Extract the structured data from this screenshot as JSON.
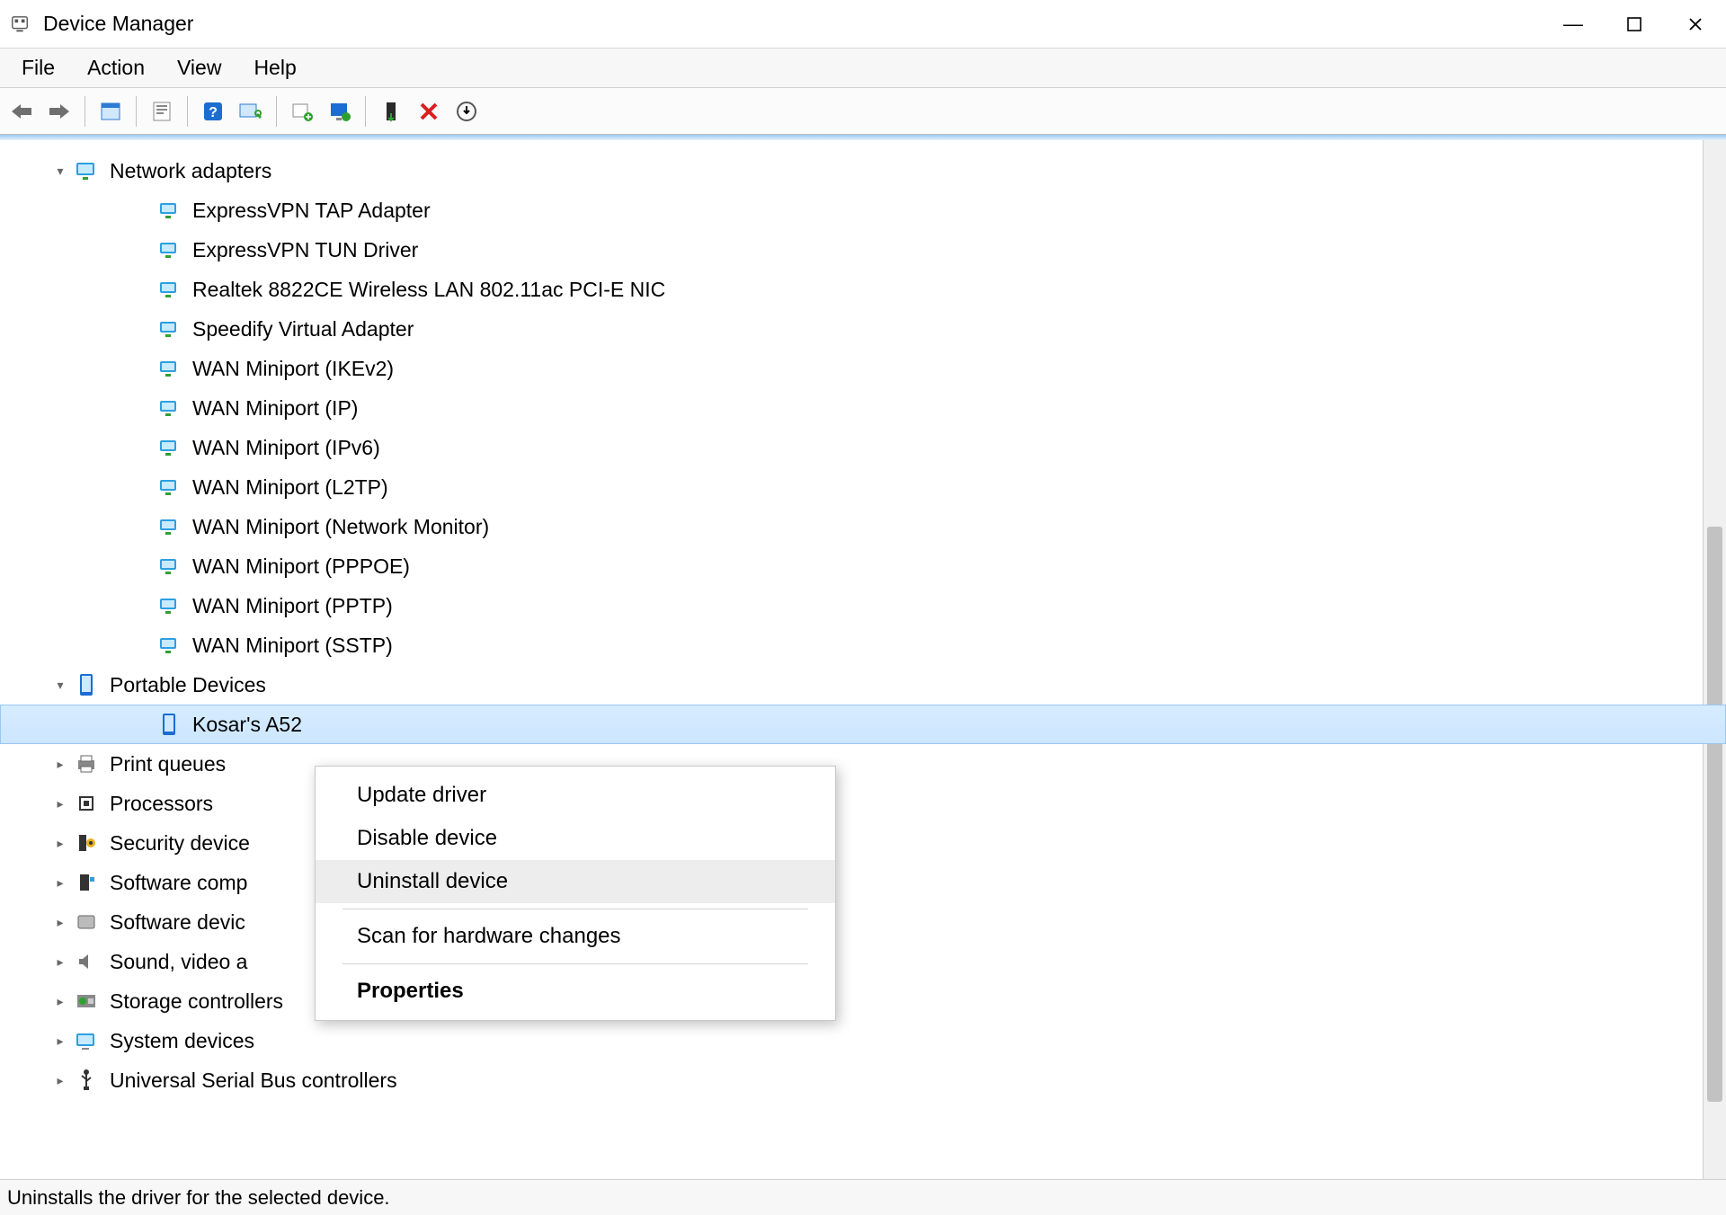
{
  "title": "Device Manager",
  "window_controls": {
    "min": "—",
    "max": "▢",
    "close": "✕"
  },
  "menu": {
    "file": "File",
    "action": "Action",
    "view": "View",
    "help": "Help"
  },
  "toolbar_icons": {
    "back": "back",
    "forward": "forward",
    "show_hidden": "show-hidden",
    "properties": "properties",
    "help": "help",
    "refresh": "refresh",
    "update_driver": "update-driver",
    "enable": "enable",
    "uninstall": "uninstall",
    "delete": "delete",
    "scan": "scan"
  },
  "tree": {
    "network_adapters": {
      "label": "Network adapters",
      "items": [
        "ExpressVPN TAP Adapter",
        "ExpressVPN TUN Driver",
        "Realtek 8822CE Wireless LAN 802.11ac PCI-E NIC",
        "Speedify Virtual Adapter",
        "WAN Miniport (IKEv2)",
        "WAN Miniport (IP)",
        "WAN Miniport (IPv6)",
        "WAN Miniport (L2TP)",
        "WAN Miniport (Network Monitor)",
        "WAN Miniport (PPPOE)",
        "WAN Miniport (PPTP)",
        "WAN Miniport (SSTP)"
      ]
    },
    "portable_devices": {
      "label": "Portable Devices",
      "selected_item": "Kosar's A52"
    },
    "print_queues": "Print queues",
    "processors": "Processors",
    "security_devices": "Security device",
    "software_components": "Software comp",
    "software_devices": "Software devic",
    "sound": "Sound, video a",
    "storage_controllers": "Storage controllers",
    "system_devices": "System devices",
    "usb_controllers": "Universal Serial Bus controllers"
  },
  "context_menu": {
    "update_driver": "Update driver",
    "disable_device": "Disable device",
    "uninstall_device": "Uninstall device",
    "scan_hw": "Scan for hardware changes",
    "properties": "Properties"
  },
  "statusbar": "Uninstalls the driver for the selected device."
}
